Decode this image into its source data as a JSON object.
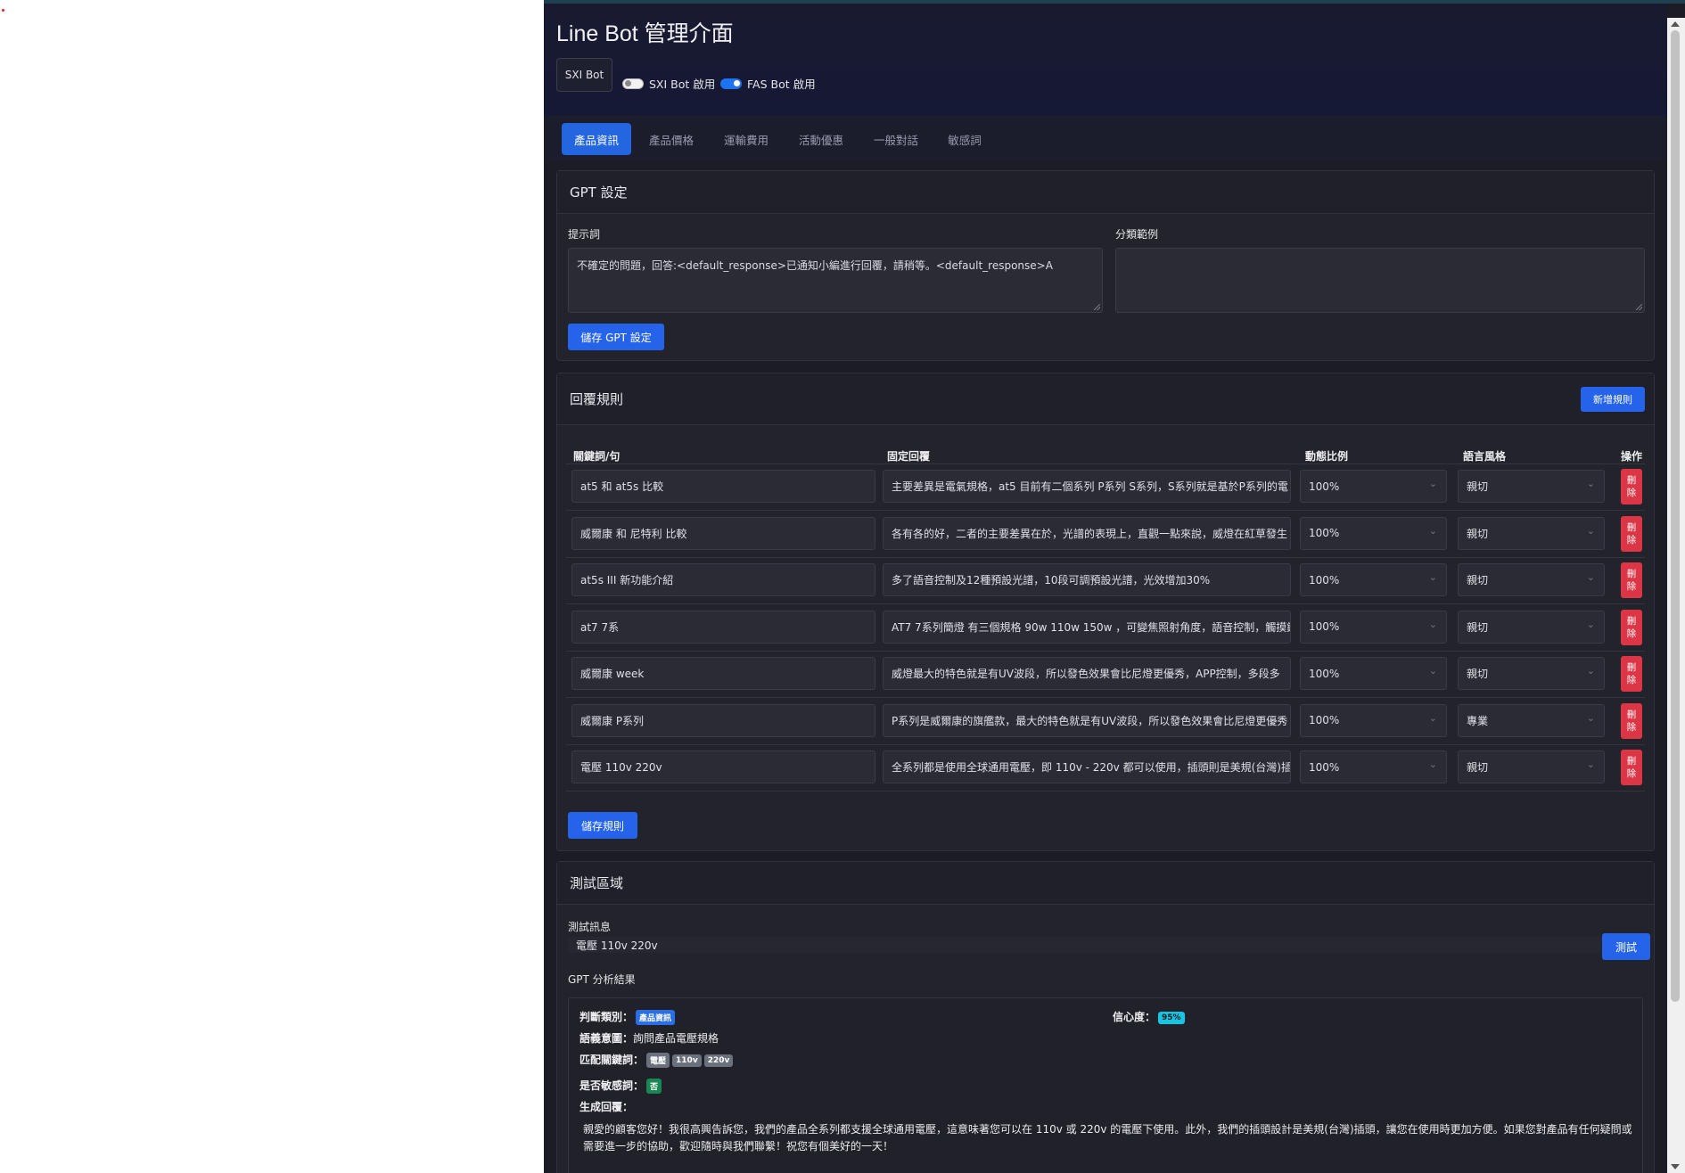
{
  "title": "Line Bot 管理介面",
  "bot_button": "SXI Bot",
  "toggles": [
    {
      "label": "SXI Bot 啟用",
      "on": false
    },
    {
      "label": "FAS Bot 啟用",
      "on": true
    }
  ],
  "tabs": [
    "產品資訊",
    "產品價格",
    "運輸費用",
    "活動優惠",
    "一般對話",
    "敏感詞"
  ],
  "active_tab": "產品資訊",
  "gpt": {
    "header": "GPT 設定",
    "prompt_label": "提示詞",
    "prompt_value": "不確定的問題，回答:<default_response>已通知小編進行回覆，請稍等。<default_response>A",
    "examples_label": "分類範例",
    "examples_value": "",
    "save": "儲存 GPT 設定"
  },
  "rules": {
    "header": "回覆規則",
    "add": "新增規則",
    "columns": [
      "關鍵詞/句",
      "固定回覆",
      "動態比例",
      "語言風格",
      "操作"
    ],
    "rows": [
      {
        "keyword": "at5 和 at5s 比較",
        "reply": "主要差異是電氣規格，at5 目前有二個系列 P系列 S系列，S系列就是基於P系列的電",
        "ratio": "100%",
        "style": "親切"
      },
      {
        "keyword": "威爾康 和 尼特利 比較",
        "reply": "各有各的好，二者的主要差異在於，光譜的表現上，直觀一點來說，威燈在紅草發生",
        "ratio": "100%",
        "style": "親切"
      },
      {
        "keyword": "at5s III 新功能介紹",
        "reply": "多了語音控制及12種預設光譜，10段可調預設光譜，光效增加30%",
        "ratio": "100%",
        "style": "親切"
      },
      {
        "keyword": "at7 7系",
        "reply": "AT7 7系列簡燈 有三個規格 90w 110w 150w ，可變焦照射角度，語音控制，觸摸鍵",
        "ratio": "100%",
        "style": "親切"
      },
      {
        "keyword": "威爾康 week",
        "reply": "威燈最大的特色就是有UV波段，所以發色效果會比尼燈更優秀，APP控制，多段多",
        "ratio": "100%",
        "style": "親切"
      },
      {
        "keyword": "威爾康 P系列",
        "reply": "P系列是威爾康的旗艦款，最大的特色就是有UV波段，所以發色效果會比尼燈更優秀",
        "ratio": "100%",
        "style": "專業"
      },
      {
        "keyword": "電壓 110v 220v",
        "reply": "全系列都是使用全球通用電壓，即 110v - 220v 都可以使用，插頭則是美規(台灣)插",
        "ratio": "100%",
        "style": "親切"
      }
    ],
    "delete_label": [
      "刪",
      "除"
    ],
    "save": "儲存規則"
  },
  "test": {
    "header": "測試區域",
    "msg_label": "測試訊息",
    "msg_value": "電壓 110v 220v",
    "btn": "測試",
    "result_title": "GPT 分析結果",
    "category_key": "判斷類別：",
    "category_val": "產品資訊",
    "confidence_key": "信心度：",
    "confidence_val": "95%",
    "intent_key": "語義意圖：",
    "intent_val": "詢問產品電壓規格",
    "keywords_key": "匹配關鍵詞：",
    "keywords": [
      "電壓",
      "110v",
      "220v"
    ],
    "sensitive_key": "是否敏感詞：",
    "sensitive_val": "否",
    "gen_key": "生成回覆：",
    "gen_val": "親愛的顧客您好！我很高興告訴您，我們的產品全系列都支援全球通用電壓，這意味著您可以在 110v 或 220v 的電壓下使用。此外，我們的插頭設計是美規(台灣)插頭，讓您在使用時更加方便。如果您對產品有任何疑問或需要進一步的協助，歡迎隨時與我們聯繫！祝您有個美好的一天！"
  },
  "colors": {
    "accent": "#2563eb",
    "danger": "#dc3545",
    "background": "#1c1d24"
  }
}
